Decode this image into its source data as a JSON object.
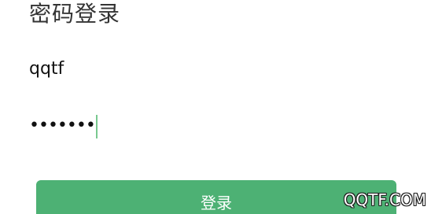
{
  "title": "密码登录",
  "username": {
    "value": "qqtf"
  },
  "password": {
    "display": "•••••••"
  },
  "login_button": {
    "label": "登录",
    "color": "#4db174"
  },
  "watermark": {
    "text": "QQTF.COM"
  },
  "colors": {
    "cursor": "#79c98f",
    "title": "#333333",
    "text": "#111111"
  }
}
